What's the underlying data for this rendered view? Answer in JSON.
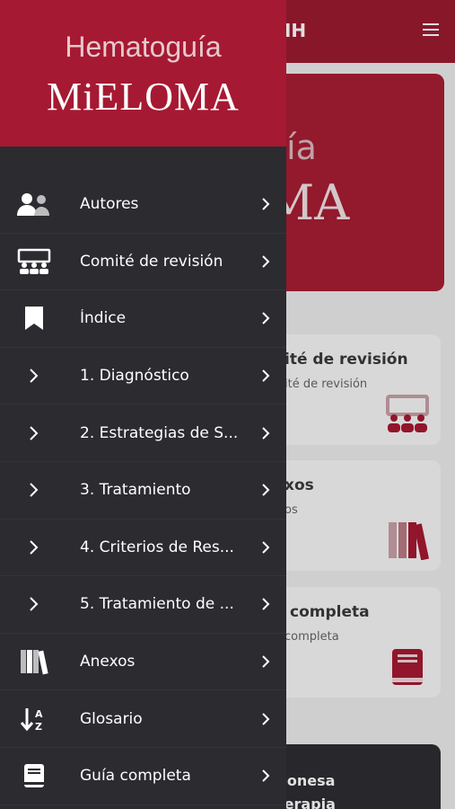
{
  "background": {
    "topbar_title": ".HH",
    "hero_line1": "uía",
    "hero_line2": "MA",
    "cards": [
      {
        "title": "ité de revisión",
        "subtitle": "ité de revisión",
        "icon": "committee-icon"
      },
      {
        "title": "xos",
        "subtitle": "os",
        "icon": "books-icon"
      },
      {
        "title": "completa",
        "subtitle": "completa",
        "icon": "book-icon"
      }
    ],
    "dark_card_line1": "eonesa",
    "dark_card_line2": "terapia"
  },
  "drawer": {
    "brand_top": "Hematoguía",
    "brand_main": "MiELOMA",
    "items": [
      {
        "label": "Autores",
        "icon": "users-icon"
      },
      {
        "label": "Comité de revisión",
        "icon": "committee-icon"
      },
      {
        "label": "Índice",
        "icon": "bookmark-icon"
      },
      {
        "label": "1. Diagnóstico",
        "icon": "chevron-right-icon"
      },
      {
        "label": "2. Estrategias de S...",
        "icon": "chevron-right-icon"
      },
      {
        "label": "3. Tratamiento",
        "icon": "chevron-right-icon"
      },
      {
        "label": "4. Criterios de Res...",
        "icon": "chevron-right-icon"
      },
      {
        "label": "5. Tratamiento de ...",
        "icon": "chevron-right-icon"
      },
      {
        "label": "Anexos",
        "icon": "books-icon"
      },
      {
        "label": "Glosario",
        "icon": "sort-az-icon"
      },
      {
        "label": "Guía completa",
        "icon": "book-icon"
      }
    ]
  },
  "colors": {
    "brand_red": "#a61932",
    "drawer_bg": "#2b2b30",
    "accent_red": "#9b1b30"
  }
}
